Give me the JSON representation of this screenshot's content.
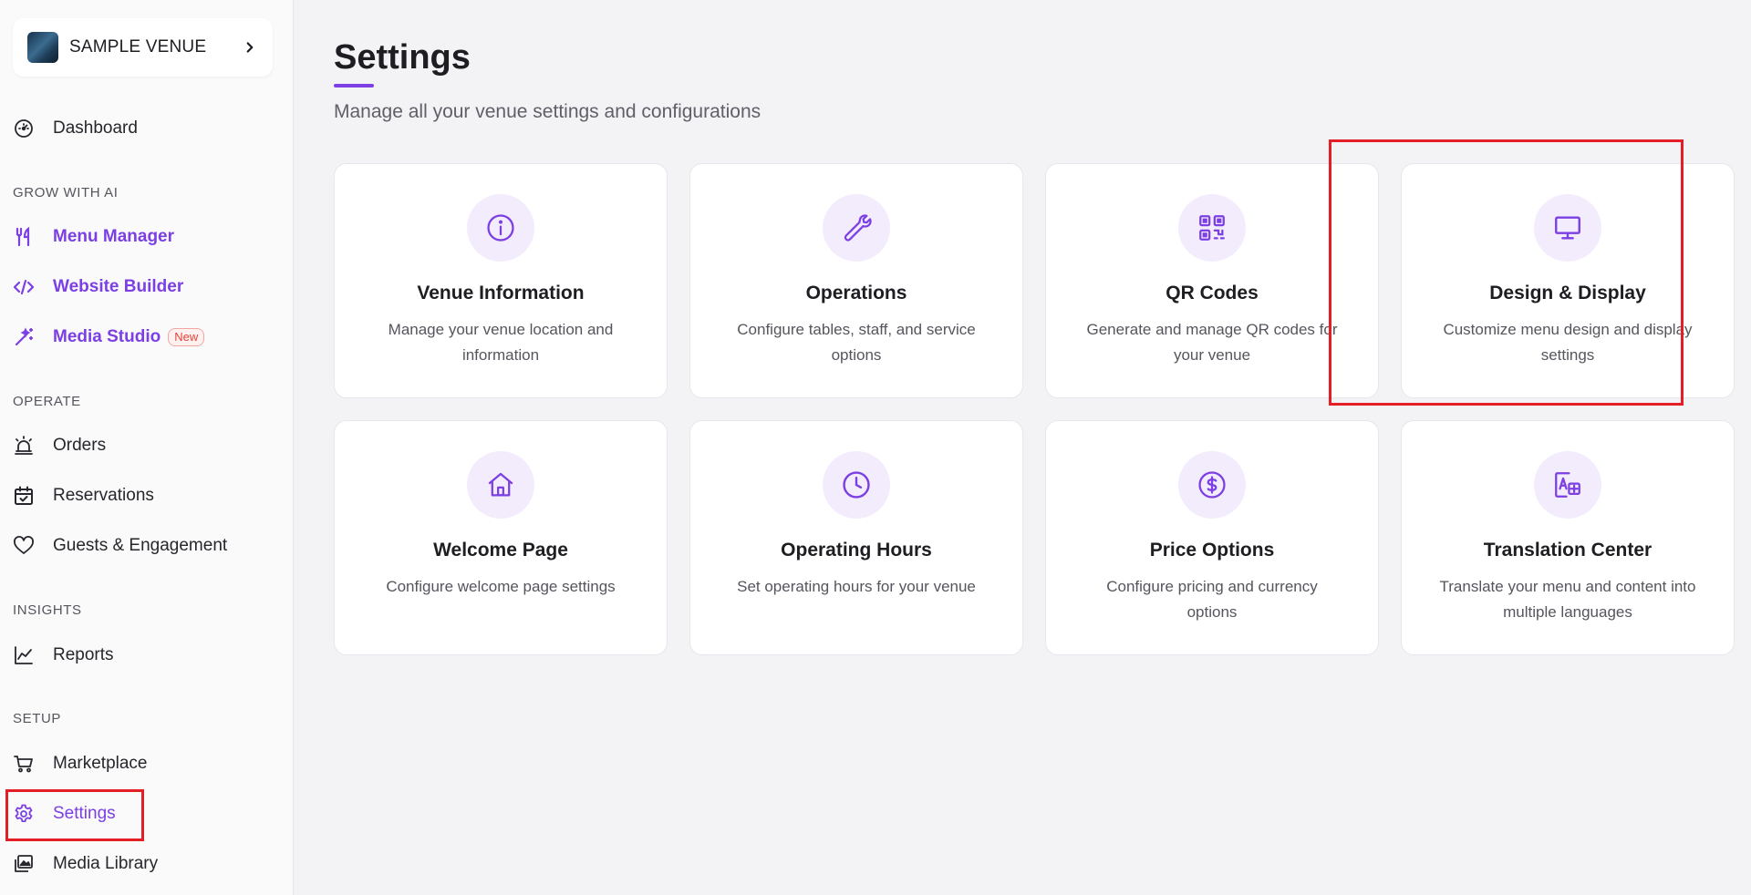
{
  "sidebar": {
    "venue": {
      "name": "SAMPLE VENUE"
    },
    "dashboard": {
      "label": "Dashboard",
      "icon": "gauge-icon"
    },
    "sections": {
      "grow": "GROW WITH AI",
      "operate": "OPERATE",
      "insights": "INSIGHTS",
      "setup": "SETUP"
    },
    "grow_items": [
      {
        "label": "Menu Manager",
        "icon": "fork-knife-icon"
      },
      {
        "label": "Website Builder",
        "icon": "code-icon"
      },
      {
        "label": "Media Studio",
        "icon": "magic-wand-icon",
        "badge": "New"
      }
    ],
    "operate_items": [
      {
        "label": "Orders",
        "icon": "alarm-bell-icon"
      },
      {
        "label": "Reservations",
        "icon": "calendar-check-icon"
      },
      {
        "label": "Guests & Engagement",
        "icon": "heart-icon"
      }
    ],
    "insights_items": [
      {
        "label": "Reports",
        "icon": "line-chart-icon"
      }
    ],
    "setup_items": [
      {
        "label": "Marketplace",
        "icon": "cart-icon"
      },
      {
        "label": "Settings",
        "icon": "gear-icon",
        "active": true
      },
      {
        "label": "Media Library",
        "icon": "images-icon"
      }
    ]
  },
  "main": {
    "title": "Settings",
    "subtitle": "Manage all your venue settings and configurations",
    "cards": [
      {
        "title": "Venue Information",
        "description": "Manage your venue location and information",
        "icon": "info-icon"
      },
      {
        "title": "Operations",
        "description": "Configure tables, staff, and service options",
        "icon": "wrench-icon"
      },
      {
        "title": "QR Codes",
        "description": "Generate and manage QR codes for your venue",
        "icon": "qr-code-icon"
      },
      {
        "title": "Design & Display",
        "description": "Customize menu design and display settings",
        "icon": "monitor-icon"
      },
      {
        "title": "Welcome Page",
        "description": "Configure welcome page settings",
        "icon": "home-icon"
      },
      {
        "title": "Operating Hours",
        "description": "Set operating hours for your venue",
        "icon": "clock-icon"
      },
      {
        "title": "Price Options",
        "description": "Configure pricing and currency options",
        "icon": "dollar-circle-icon"
      },
      {
        "title": "Translation Center",
        "description": "Translate your menu and content into multiple languages",
        "icon": "translate-icon"
      }
    ]
  },
  "colors": {
    "accent": "#7b3fe4",
    "icon_bg": "#f3ecfd",
    "highlight": "#e41e26"
  }
}
